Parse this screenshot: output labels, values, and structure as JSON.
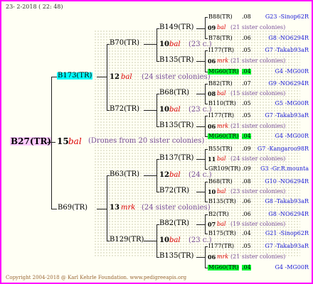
{
  "header": "23-  2-2018 ( 22: 48)",
  "footer": "Copyright 2004-2018 @ Karl Kehrle Foundation.   www.pedigreeapis.org",
  "root": {
    "name": "B27(TR)",
    "count": "15",
    "tag": "bal",
    "note": "(Drones from 20 sister colonies)"
  },
  "g1": [
    {
      "name": "B173(TR)",
      "count": "12",
      "tag": "bal",
      "note": "(24 sister colonies)"
    },
    {
      "name": "B69(TR)",
      "count": "13",
      "tag": "mrk",
      "note": "(24 sister colonies)"
    }
  ],
  "g2": [
    {
      "name": "B70(TR)",
      "count": "10",
      "tag": "bal",
      "note": "(23 c.)"
    },
    {
      "name": "B72(TR)",
      "count": "10",
      "tag": "bal",
      "note": "(23 c.)"
    },
    {
      "name": "B63(TR)",
      "count": "12",
      "tag": "bal",
      "note": "(24 c.)"
    },
    {
      "name": "B129(TR)",
      "count": "10",
      "tag": "bal",
      "note": "(23 c.)"
    }
  ],
  "g3": [
    {
      "name": "B149(TR)",
      "count": "09",
      "tag": "bal",
      "note": "(21 sister colonies)"
    },
    {
      "name": "B135(TR)",
      "count": "06",
      "tag": "mrk",
      "note": "(21 sister colonies)"
    },
    {
      "name": "B68(TR)",
      "count": "08",
      "tag": "bal",
      "note": "(15 sister colonies)"
    },
    {
      "name": "B135(TR)",
      "count": "06",
      "tag": "mrk",
      "note": "(21 sister colonies)"
    },
    {
      "name": "B137(TR)",
      "count": "11",
      "tag": "bal",
      "note": "(24 sister colonies)"
    },
    {
      "name": "B72(TR)",
      "count": "10",
      "tag": "bal",
      "note": "(23 sister colonies)"
    },
    {
      "name": "B82(TR)",
      "count": "07",
      "tag": "bal",
      "note": "(19 sister colonies)"
    },
    {
      "name": "B135(TR)",
      "count": "06",
      "tag": "mrk",
      "note": "(21 sister colonies)"
    }
  ],
  "g4": [
    {
      "name": "B88(TR)",
      "yr": ".08",
      "other": "G23 -Sinop62R"
    },
    {
      "name": "B78(TR)",
      "yr": ".06",
      "other": "G8 -NO6294R"
    },
    {
      "name": "I177(TR)",
      "yr": ".05",
      "other": "G7 -Takab93aR"
    },
    {
      "name": "MG60(TR)",
      "yr": ".04",
      "other": "G4 -MG00R"
    },
    {
      "name": "B82(TR)",
      "yr": ".07",
      "other": "G9 -NO6294R"
    },
    {
      "name": "B110(TR)",
      "yr": ".05",
      "other": "G5 -MG00R"
    },
    {
      "name": "I177(TR)",
      "yr": ".05",
      "other": "G7 -Takab93aR"
    },
    {
      "name": "MG60(TR)",
      "yr": ".04",
      "other": "G4 -MG00R"
    },
    {
      "name": "B55(TR)",
      "yr": ".09",
      "other": "G7 -Kangaroo98R"
    },
    {
      "name": "GR109(TR)",
      "yr": ".09",
      "other": "G3 -Gr.R.mounta"
    },
    {
      "name": "B68(TR)",
      "yr": ".08",
      "other": "G10 -NO6294R"
    },
    {
      "name": "B135(TR)",
      "yr": ".06",
      "other": "G8 -Takab93aR"
    },
    {
      "name": "B2(TR)",
      "yr": ".06",
      "other": "G8 -NO6294R"
    },
    {
      "name": "B175(TR)",
      "yr": ".04",
      "other": "G21 -Sinop62R"
    },
    {
      "name": "I177(TR)",
      "yr": ".05",
      "other": "G7 -Takab93aR"
    },
    {
      "name": "MG60(TR)",
      "yr": ".04",
      "other": "G4 -MG00R"
    }
  ]
}
